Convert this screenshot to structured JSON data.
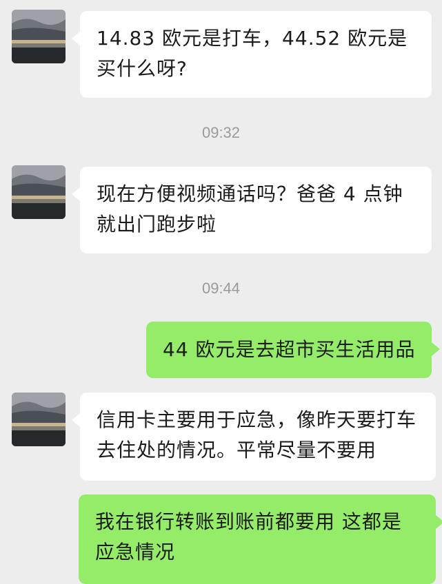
{
  "chat": {
    "messages": [
      {
        "sender": "contact",
        "avatar": "landscape-avatar",
        "text": "14.83 欧元是打车，44.52 欧元是买什么呀?"
      },
      {
        "timestamp": "09:32"
      },
      {
        "sender": "contact",
        "avatar": "landscape-avatar",
        "text": "现在方便视频通话吗？爸爸 4 点钟就出门跑步啦"
      },
      {
        "timestamp": "09:44"
      },
      {
        "sender": "self",
        "text": "44 欧元是去超市买生活用品"
      },
      {
        "sender": "contact",
        "avatar": "landscape-avatar",
        "text": "信用卡主要用于应急，像昨天要打车去住处的情况。平常尽量不要用"
      },
      {
        "sender": "self",
        "text": "我在银行转账到账前都要用 这都是应急情况"
      }
    ]
  },
  "colors": {
    "background": "#ededed",
    "incoming_bubble": "#ffffff",
    "outgoing_bubble": "#95ec69",
    "timestamp_text": "#9a9a9a"
  }
}
